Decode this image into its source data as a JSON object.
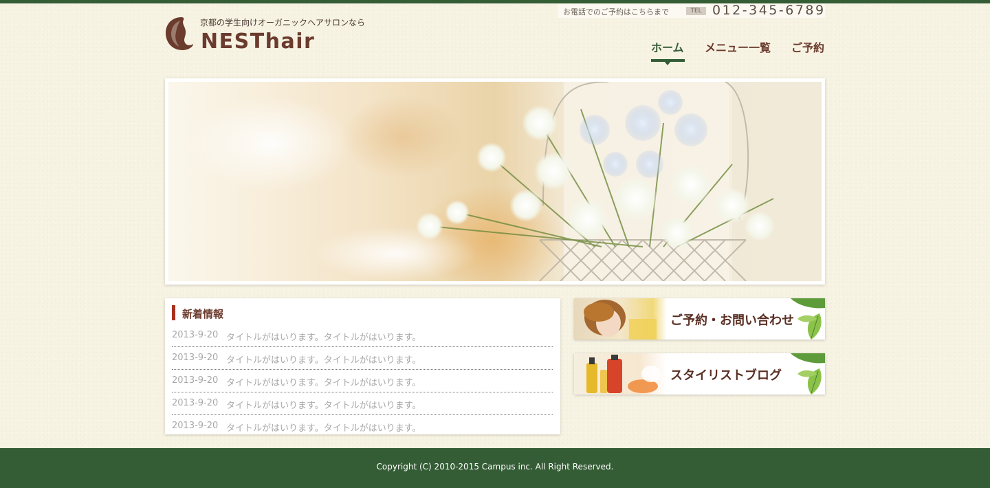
{
  "header": {
    "tagline": "京都の学生向けオーガニックヘアサロンなら",
    "brand": "NESThair",
    "tel_prompt": "お電話でのご予約はこちらまで",
    "tel_label": "TEL",
    "tel_number": "012-345-6789"
  },
  "nav": {
    "items": [
      {
        "label": "ホーム",
        "active": true
      },
      {
        "label": "メニュー一覧",
        "active": false
      },
      {
        "label": "ご予約",
        "active": false
      }
    ]
  },
  "hero": {
    "alt": "flower arrangement in wire basket"
  },
  "news": {
    "title": "新着情報",
    "items": [
      {
        "date": "2013-9-20",
        "title": "タイトルがはいります。タイトルがはいります。"
      },
      {
        "date": "2013-9-20",
        "title": "タイトルがはいります。タイトルがはいります。"
      },
      {
        "date": "2013-9-20",
        "title": "タイトルがはいります。タイトルがはいります。"
      },
      {
        "date": "2013-9-20",
        "title": "タイトルがはいります。タイトルがはいります。"
      },
      {
        "date": "2013-9-20",
        "title": "タイトルがはいります。タイトルがはいります。"
      }
    ]
  },
  "banners": {
    "reservation": "ご予約・お問い合わせ",
    "blog": "スタイリストブログ"
  },
  "footer": {
    "copyright": "Copyright (C) 2010-2015 Campus inc. All Right Reserved."
  },
  "colors": {
    "brand_green": "#345c35",
    "brand_brown": "#6b3b2e",
    "accent_red": "#a8301f",
    "background": "#f7f3e3"
  }
}
